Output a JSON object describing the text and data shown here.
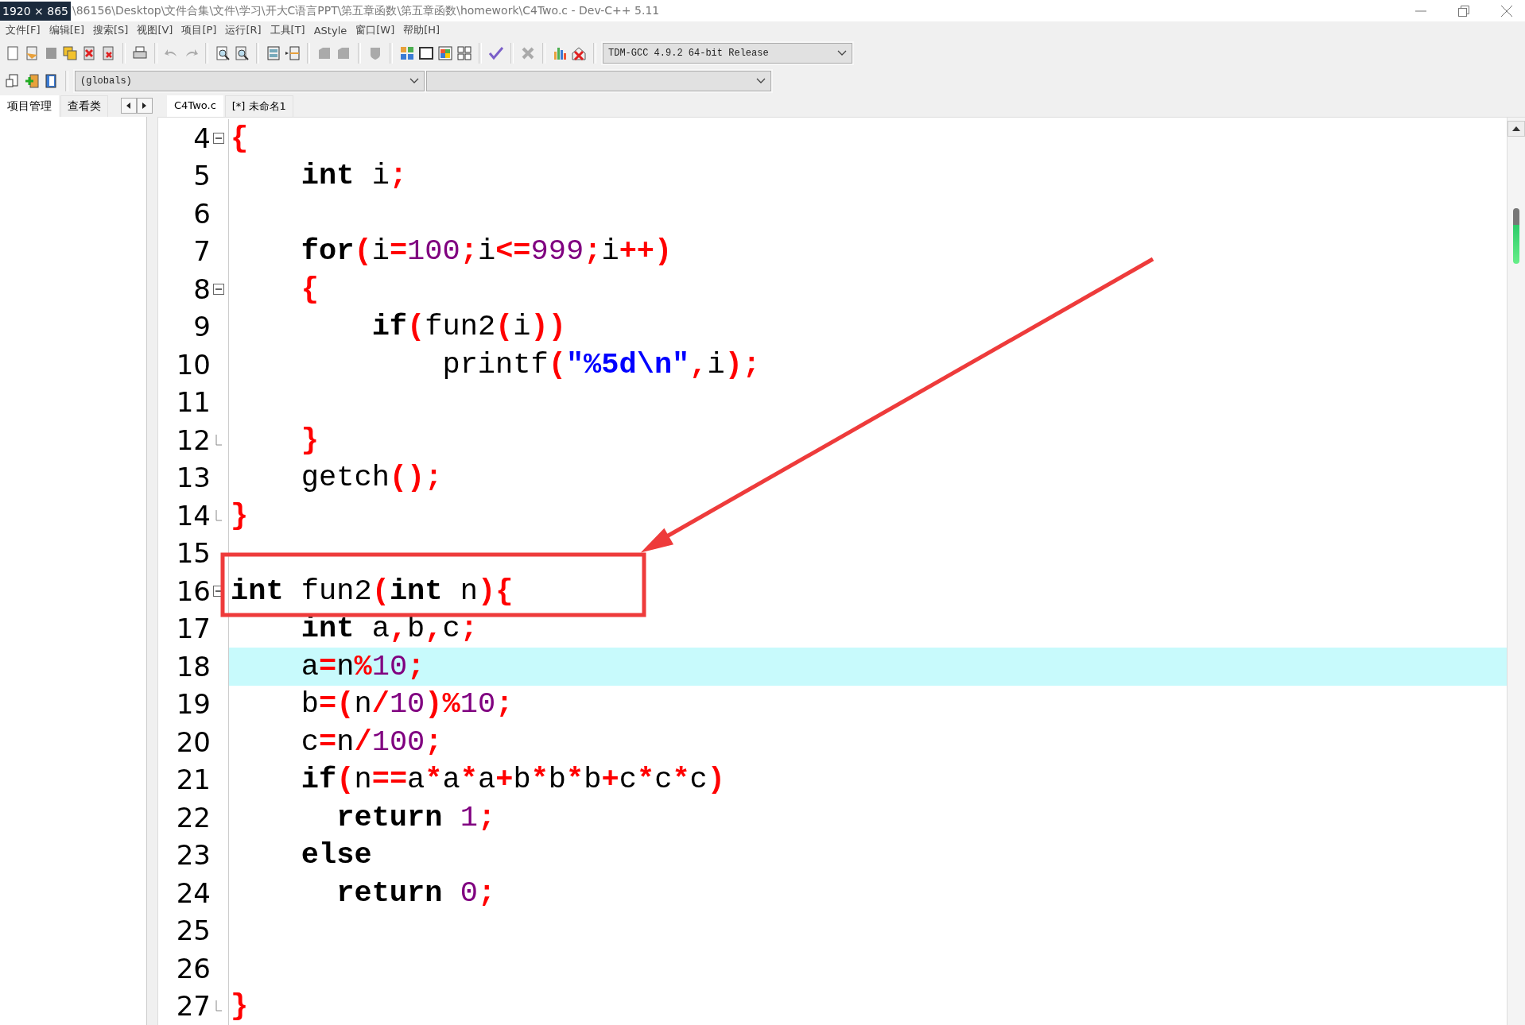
{
  "overlay_badge": "1920 × 865",
  "window": {
    "title": "\\86156\\Desktop\\文件合集\\文件\\学习\\开大C语言PPT\\第五章函数\\第五章函数\\homework\\C4Two.c - Dev-C++ 5.11"
  },
  "menu": [
    "文件[F]",
    "编辑[E]",
    "搜索[S]",
    "视图[V]",
    "项目[P]",
    "运行[R]",
    "工具[T]",
    "AStyle",
    "窗口[W]",
    "帮助[H]"
  ],
  "compiler_select": {
    "value": "TDM-GCC 4.9.2 64-bit Release"
  },
  "scope_select": {
    "value": "(globals)"
  },
  "side_tabs": [
    {
      "label": "项目管理",
      "selected": true
    },
    {
      "label": "查看类",
      "selected": false
    }
  ],
  "editor_tabs": [
    {
      "label": "C4Two.c",
      "selected": true
    },
    {
      "label": "[*] 未命名1",
      "selected": false
    }
  ],
  "code_lines": [
    {
      "number": "4",
      "fold_start": true,
      "fold_end": false,
      "selected": false,
      "segments": [
        {
          "kind": "op",
          "text": "{"
        }
      ]
    },
    {
      "number": "5",
      "fold_start": false,
      "fold_end": false,
      "selected": false,
      "segments": [
        {
          "kind": "kw",
          "text": "    int"
        },
        {
          "kind": "plain",
          "text": " i"
        },
        {
          "kind": "op",
          "text": ";"
        }
      ]
    },
    {
      "number": "6",
      "fold_start": false,
      "fold_end": false,
      "selected": false
    },
    {
      "number": "7",
      "fold_start": false,
      "fold_end": false,
      "selected": false,
      "segments": [
        {
          "kind": "kw",
          "text": "    for"
        },
        {
          "kind": "op",
          "text": "("
        },
        {
          "kind": "plain",
          "text": "i"
        },
        {
          "kind": "op",
          "text": "="
        },
        {
          "kind": "num",
          "text": "100"
        },
        {
          "kind": "op",
          "text": ";"
        },
        {
          "kind": "plain",
          "text": "i"
        },
        {
          "kind": "op",
          "text": "<="
        },
        {
          "kind": "num",
          "text": "999"
        },
        {
          "kind": "op",
          "text": ";"
        },
        {
          "kind": "plain",
          "text": "i"
        },
        {
          "kind": "op",
          "text": "++)"
        }
      ]
    },
    {
      "number": "8",
      "fold_start": true,
      "fold_end": false,
      "selected": false,
      "segments": [
        {
          "kind": "op",
          "text": "    {"
        }
      ]
    },
    {
      "number": "9",
      "fold_start": false,
      "fold_end": false,
      "selected": false,
      "segments": [
        {
          "kind": "kw",
          "text": "        if"
        },
        {
          "kind": "op",
          "text": "("
        },
        {
          "kind": "plain",
          "text": "fun2"
        },
        {
          "kind": "op",
          "text": "("
        },
        {
          "kind": "plain",
          "text": "i"
        },
        {
          "kind": "op",
          "text": "))"
        }
      ]
    },
    {
      "number": "10",
      "fold_start": false,
      "fold_end": false,
      "selected": false,
      "segments": [
        {
          "kind": "plain",
          "text": "            printf"
        },
        {
          "kind": "op",
          "text": "("
        },
        {
          "kind": "str",
          "text": "\"%5d\\n\""
        },
        {
          "kind": "op",
          "text": ","
        },
        {
          "kind": "plain",
          "text": "i"
        },
        {
          "kind": "op",
          "text": ");"
        }
      ]
    },
    {
      "number": "11",
      "fold_start": false,
      "fold_end": false,
      "selected": false
    },
    {
      "number": "12",
      "fold_start": false,
      "fold_end": true,
      "selected": false,
      "segments": [
        {
          "kind": "op",
          "text": "    }"
        }
      ]
    },
    {
      "number": "13",
      "fold_start": false,
      "fold_end": false,
      "selected": false,
      "segments": [
        {
          "kind": "plain",
          "text": "    getch"
        },
        {
          "kind": "op",
          "text": "();"
        }
      ]
    },
    {
      "number": "14",
      "fold_start": false,
      "fold_end": true,
      "selected": false,
      "segments": [
        {
          "kind": "op",
          "text": "}"
        }
      ]
    },
    {
      "number": "15",
      "fold_start": false,
      "fold_end": false,
      "selected": false
    },
    {
      "number": "16",
      "fold_start": true,
      "fold_end": false,
      "selected": false,
      "segments": [
        {
          "kind": "kw",
          "text": "int"
        },
        {
          "kind": "plain",
          "text": " fun2"
        },
        {
          "kind": "op",
          "text": "("
        },
        {
          "kind": "kw",
          "text": "int"
        },
        {
          "kind": "plain",
          "text": " n"
        },
        {
          "kind": "op",
          "text": "){"
        }
      ]
    },
    {
      "number": "17",
      "fold_start": false,
      "fold_end": false,
      "selected": false,
      "segments": [
        {
          "kind": "kw",
          "text": "    int"
        },
        {
          "kind": "plain",
          "text": " a"
        },
        {
          "kind": "op",
          "text": ","
        },
        {
          "kind": "plain",
          "text": "b"
        },
        {
          "kind": "op",
          "text": ","
        },
        {
          "kind": "plain",
          "text": "c"
        },
        {
          "kind": "op",
          "text": ";"
        }
      ]
    },
    {
      "number": "18",
      "fold_start": false,
      "fold_end": false,
      "selected": true,
      "segments": [
        {
          "kind": "plain",
          "text": "    a"
        },
        {
          "kind": "op",
          "text": "="
        },
        {
          "kind": "plain",
          "text": "n"
        },
        {
          "kind": "op",
          "text": "%"
        },
        {
          "kind": "num",
          "text": "10"
        },
        {
          "kind": "op",
          "text": ";"
        }
      ]
    },
    {
      "number": "19",
      "fold_start": false,
      "fold_end": false,
      "selected": false,
      "segments": [
        {
          "kind": "plain",
          "text": "    b"
        },
        {
          "kind": "op",
          "text": "=("
        },
        {
          "kind": "plain",
          "text": "n"
        },
        {
          "kind": "op",
          "text": "/"
        },
        {
          "kind": "num",
          "text": "10"
        },
        {
          "kind": "op",
          "text": ")%"
        },
        {
          "kind": "num",
          "text": "10"
        },
        {
          "kind": "op",
          "text": ";"
        }
      ]
    },
    {
      "number": "20",
      "fold_start": false,
      "fold_end": false,
      "selected": false,
      "segments": [
        {
          "kind": "plain",
          "text": "    c"
        },
        {
          "kind": "op",
          "text": "="
        },
        {
          "kind": "plain",
          "text": "n"
        },
        {
          "kind": "op",
          "text": "/"
        },
        {
          "kind": "num",
          "text": "100"
        },
        {
          "kind": "op",
          "text": ";"
        }
      ]
    },
    {
      "number": "21",
      "fold_start": false,
      "fold_end": false,
      "selected": false,
      "segments": [
        {
          "kind": "kw",
          "text": "    if"
        },
        {
          "kind": "op",
          "text": "("
        },
        {
          "kind": "plain",
          "text": "n"
        },
        {
          "kind": "op",
          "text": "=="
        },
        {
          "kind": "plain",
          "text": "a"
        },
        {
          "kind": "op",
          "text": "*"
        },
        {
          "kind": "plain",
          "text": "a"
        },
        {
          "kind": "op",
          "text": "*"
        },
        {
          "kind": "plain",
          "text": "a"
        },
        {
          "kind": "op",
          "text": "+"
        },
        {
          "kind": "plain",
          "text": "b"
        },
        {
          "kind": "op",
          "text": "*"
        },
        {
          "kind": "plain",
          "text": "b"
        },
        {
          "kind": "op",
          "text": "*"
        },
        {
          "kind": "plain",
          "text": "b"
        },
        {
          "kind": "op",
          "text": "+"
        },
        {
          "kind": "plain",
          "text": "c"
        },
        {
          "kind": "op",
          "text": "*"
        },
        {
          "kind": "plain",
          "text": "c"
        },
        {
          "kind": "op",
          "text": "*"
        },
        {
          "kind": "plain",
          "text": "c"
        },
        {
          "kind": "op",
          "text": ")"
        }
      ]
    },
    {
      "number": "22",
      "fold_start": false,
      "fold_end": false,
      "selected": false,
      "segments": [
        {
          "kind": "kw",
          "text": "      return"
        },
        {
          "kind": "num",
          "text": " 1"
        },
        {
          "kind": "op",
          "text": ";"
        }
      ]
    },
    {
      "number": "23",
      "fold_start": false,
      "fold_end": false,
      "selected": false,
      "segments": [
        {
          "kind": "kw",
          "text": "    else"
        }
      ]
    },
    {
      "number": "24",
      "fold_start": false,
      "fold_end": false,
      "selected": false,
      "segments": [
        {
          "kind": "kw",
          "text": "      return"
        },
        {
          "kind": "num",
          "text": " 0"
        },
        {
          "kind": "op",
          "text": ";"
        }
      ]
    },
    {
      "number": "25",
      "fold_start": false,
      "fold_end": false,
      "selected": false
    },
    {
      "number": "26",
      "fold_start": false,
      "fold_end": false,
      "selected": false
    },
    {
      "number": "27",
      "fold_start": false,
      "fold_end": true,
      "selected": false,
      "segments": [
        {
          "kind": "op",
          "text": "}"
        }
      ]
    }
  ]
}
